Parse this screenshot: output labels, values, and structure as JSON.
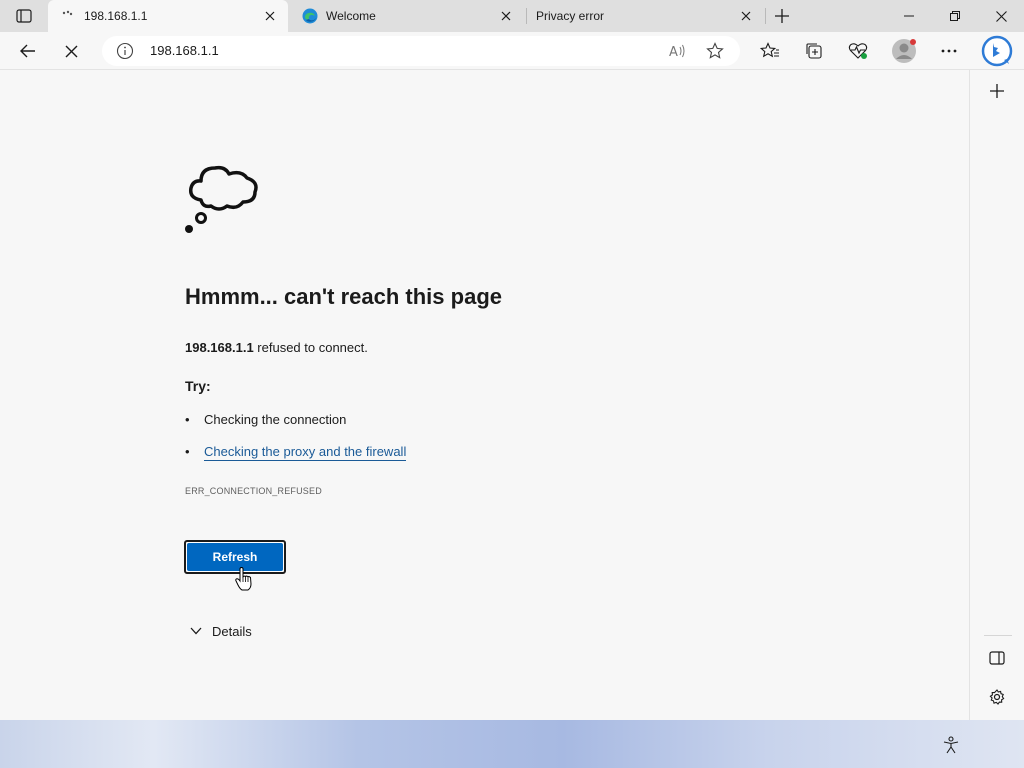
{
  "tabs": [
    {
      "title": "198.168.1.1",
      "active": true,
      "favicon": "loading-icon"
    },
    {
      "title": "Welcome",
      "active": false,
      "favicon": "edge-logo-icon"
    },
    {
      "title": "Privacy error",
      "active": false,
      "favicon": ""
    }
  ],
  "toolbar": {
    "url": "198.168.1.1"
  },
  "error_page": {
    "heading": "Hmmm... can't reach this page",
    "host": "198.168.1.1",
    "message_suffix": " refused to connect.",
    "try_label": "Try:",
    "suggestions": [
      {
        "text": "Checking the connection",
        "link": false
      },
      {
        "text": "Checking the proxy and the firewall",
        "link": true
      }
    ],
    "error_code": "ERR_CONNECTION_REFUSED",
    "refresh_label": "Refresh",
    "details_label": "Details"
  },
  "colors": {
    "accent": "#0067c0",
    "link": "#1a5a97"
  }
}
